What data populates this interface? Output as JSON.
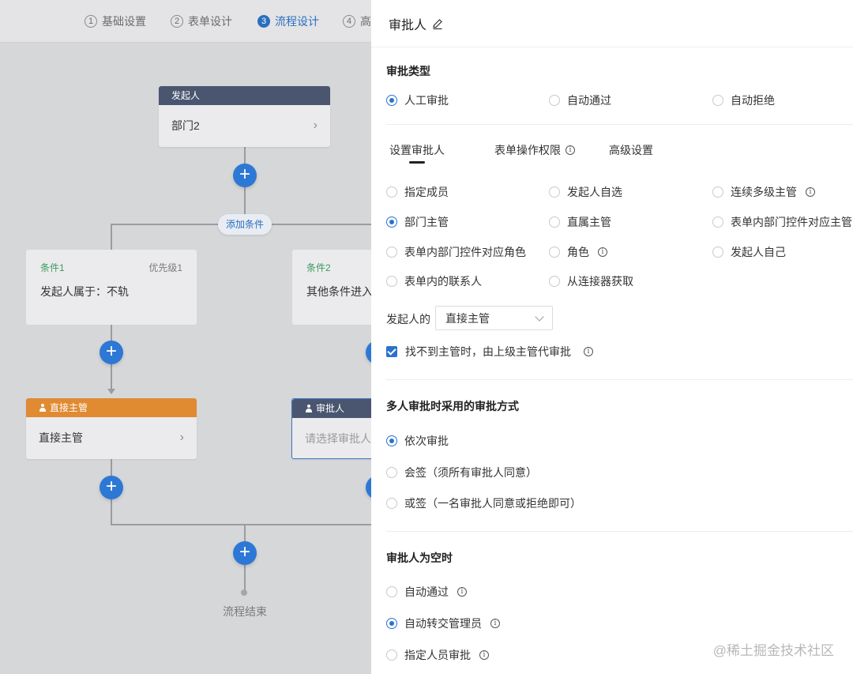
{
  "steps": [
    {
      "num": "1",
      "label": "基础设置"
    },
    {
      "num": "2",
      "label": "表单设计"
    },
    {
      "num": "3",
      "label": "流程设计"
    },
    {
      "num": "4",
      "label": "高"
    }
  ],
  "flow": {
    "initiator": {
      "title": "发起人",
      "value": "部门2",
      "header_color": "#4a5670"
    },
    "add_condition": "添加条件",
    "conditions": [
      {
        "name": "条件1",
        "priority": "优先级1",
        "desc": "发起人属于：不轨"
      },
      {
        "name": "条件2",
        "desc": "其他条件进入"
      }
    ],
    "approvers": [
      {
        "title": "直接主管",
        "value": "直接主管",
        "header_color": "#e08a32"
      },
      {
        "title": "审批人",
        "value": "请选择审批人",
        "header_color": "#4a5670"
      }
    ],
    "add_symbol": "+",
    "end_label": "流程结束"
  },
  "panel": {
    "title": "审批人",
    "approval_type": {
      "title": "审批类型",
      "options": [
        {
          "label": "人工审批",
          "selected": true
        },
        {
          "label": "自动通过",
          "selected": false
        },
        {
          "label": "自动拒绝",
          "selected": false
        }
      ]
    },
    "tabs": [
      {
        "label": "设置审批人",
        "active": true
      },
      {
        "label": "表单操作权限",
        "info": true
      },
      {
        "label": "高级设置"
      }
    ],
    "approver_options": [
      {
        "label": "指定成员",
        "selected": false
      },
      {
        "label": "发起人自选",
        "selected": false
      },
      {
        "label": "连续多级主管",
        "selected": false,
        "info": true
      },
      {
        "label": "部门主管",
        "selected": true
      },
      {
        "label": "直属主管",
        "selected": false
      },
      {
        "label": "表单内部门控件对应主管",
        "selected": false
      },
      {
        "label": "表单内部门控件对应角色",
        "selected": false
      },
      {
        "label": "角色",
        "selected": false,
        "info": true
      },
      {
        "label": "发起人自己",
        "selected": false
      },
      {
        "label": "表单内的联系人",
        "selected": false
      },
      {
        "label": "从连接器获取",
        "selected": false
      }
    ],
    "initiator_of": {
      "label": "发起人的",
      "value": "直接主管"
    },
    "fallback_checkbox": {
      "label": "找不到主管时，由上级主管代审批",
      "checked": true
    },
    "multi_approval": {
      "title": "多人审批时采用的审批方式",
      "options": [
        {
          "label": "依次审批",
          "selected": true
        },
        {
          "label": "会签（须所有审批人同意）",
          "selected": false
        },
        {
          "label": "或签（一名审批人同意或拒绝即可）",
          "selected": false
        }
      ]
    },
    "empty_approver": {
      "title": "审批人为空时",
      "options": [
        {
          "label": "自动通过",
          "selected": false,
          "info": true
        },
        {
          "label": "自动转交管理员",
          "selected": true,
          "info": true
        },
        {
          "label": "指定人员审批",
          "selected": false,
          "info": true
        }
      ]
    },
    "watermark": "@稀土掘金技术社区"
  }
}
